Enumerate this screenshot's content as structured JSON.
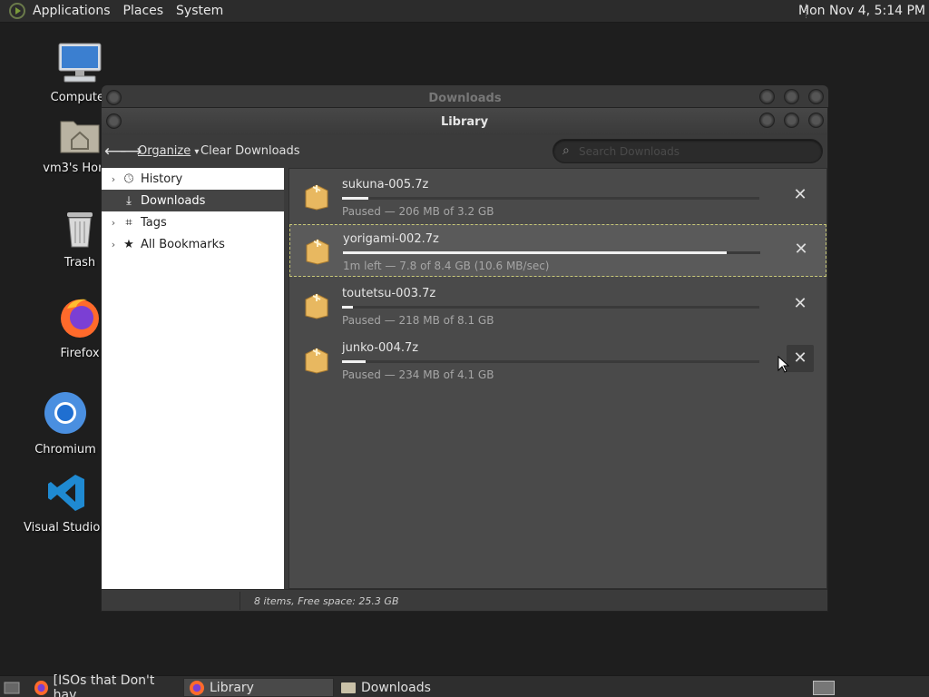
{
  "top_panel": {
    "menus": [
      "Applications",
      "Places",
      "System"
    ],
    "clock": "Mon Nov  4,  5:14 PM"
  },
  "desktop": {
    "icons": [
      {
        "label": "Computer",
        "icon": "computer-icon"
      },
      {
        "label": "vm3's Home",
        "icon": "home-folder-icon"
      },
      {
        "label": "Trash",
        "icon": "trash-icon"
      },
      {
        "label": "Firefox",
        "icon": "firefox-icon"
      },
      {
        "label": "Chromium",
        "icon": "chromium-icon"
      },
      {
        "label": "Visual Studio Code",
        "icon": "vscode-icon"
      }
    ]
  },
  "back_window": {
    "title": "Downloads"
  },
  "window": {
    "title": "Library",
    "toolbar": {
      "organize": "Organize",
      "clear_downloads": "Clear Downloads",
      "search_placeholder": "Search Downloads"
    },
    "sidebar": {
      "items": [
        {
          "label": "History",
          "icon": "clock-icon",
          "expandable": true
        },
        {
          "label": "Downloads",
          "icon": "download-icon",
          "expandable": false,
          "selected": true
        },
        {
          "label": "Tags",
          "icon": "tag-icon",
          "expandable": true
        },
        {
          "label": "All Bookmarks",
          "icon": "star-icon",
          "expandable": true
        }
      ]
    },
    "downloads": [
      {
        "name": "sukuna-005.7z",
        "status": "Paused — 206 MB of 3.2 GB",
        "progress": 0.064
      },
      {
        "name": "yorigami-002.7z",
        "status": "1m left — 7.8 of 8.4 GB (10.6 MB/sec)",
        "progress": 0.92,
        "selected": true
      },
      {
        "name": "toutetsu-003.7z",
        "status": "Paused — 218 MB of 8.1 GB",
        "progress": 0.027
      },
      {
        "name": "junko-004.7z",
        "status": "Paused — 234 MB of 4.1 GB",
        "progress": 0.057
      }
    ],
    "statusbar": "8 items, Free space: 25.3 GB"
  },
  "taskbar": {
    "tasks": [
      {
        "label": "[ISOs that Don't hav...",
        "icon": "firefox-icon"
      },
      {
        "label": "Library",
        "icon": "firefox-icon",
        "active": true
      },
      {
        "label": "Downloads",
        "icon": "folder-icon"
      }
    ]
  },
  "colors": {
    "accent_selection_border": "#c8c878",
    "sidebar_bg": "#ffffff",
    "list_bg": "#4a4a4a"
  }
}
